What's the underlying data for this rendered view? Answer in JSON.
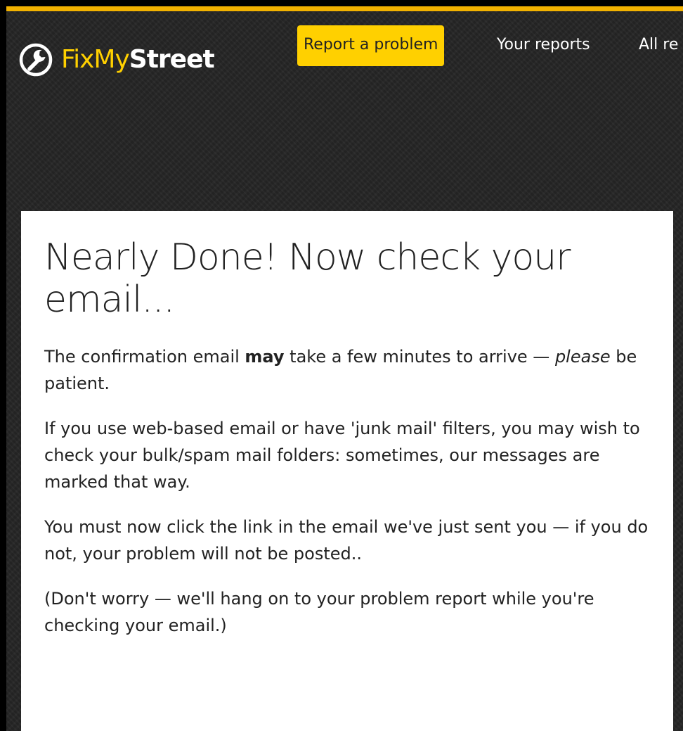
{
  "header": {
    "logo": {
      "icon": "wrench-icon",
      "fixmy": "FixMy",
      "street": "Street"
    },
    "nav": {
      "report_label": "Report a problem",
      "your_reports_label": "Your reports",
      "all_reports_label": "All re"
    }
  },
  "main": {
    "title": "Nearly Done! Now check your email...",
    "p1": {
      "before": "The confirmation email ",
      "bold": "may",
      "after": " take a few minutes to arrive — ",
      "italic": "please",
      "end": " be patient."
    },
    "p2": "If you use web-based email or have 'junk mail' filters, you may wish to check your bulk/spam mail folders: sometimes, our messages are marked that way.",
    "p3": "You must now click the link in the email we've just sent you — if you do not, your problem will not be posted..",
    "p4": "(Don't worry — we'll hang on to your problem report while you're checking your email.)"
  },
  "colors": {
    "accent": "#ffd000",
    "header_bg": "#262626",
    "text": "#222222"
  }
}
